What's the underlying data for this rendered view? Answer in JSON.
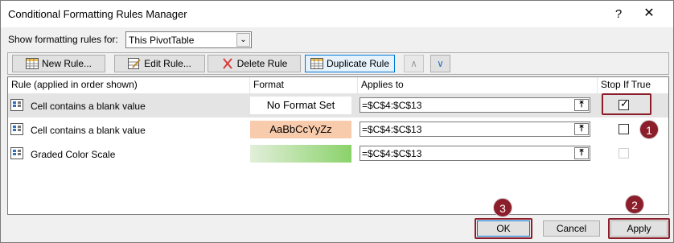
{
  "window": {
    "title": "Conditional Formatting Rules Manager",
    "help": "?",
    "close": "✕"
  },
  "show_rules": {
    "label": "Show formatting rules for:",
    "selected": "This PivotTable"
  },
  "toolbar": {
    "new_rule": "New Rule...",
    "edit_rule": "Edit Rule...",
    "delete_rule": "Delete Rule",
    "duplicate_rule": "Duplicate Rule"
  },
  "grid": {
    "headers": [
      "Rule (applied in order shown)",
      "Format",
      "Applies to",
      "Stop If True"
    ],
    "rows": [
      {
        "rule": "Cell contains a blank value",
        "format": "No Format Set",
        "applies": "=$C$4:$C$13",
        "stop": true
      },
      {
        "rule": "Cell contains a blank value",
        "format": "AaBbCcYyZz",
        "applies": "=$C$4:$C$13",
        "stop": false
      },
      {
        "rule": "Graded Color Scale",
        "format": "",
        "applies": "=$C$4:$C$13",
        "stop": false
      }
    ]
  },
  "annotations": [
    "1",
    "2",
    "3"
  ],
  "colors": {
    "annotation": "#8b1e2a",
    "format_fill": "#f8cbad",
    "scale_start": "#e2efda",
    "scale_end": "#8ad26a"
  },
  "footer": {
    "ok": "OK",
    "cancel": "Cancel",
    "apply": "Apply"
  }
}
